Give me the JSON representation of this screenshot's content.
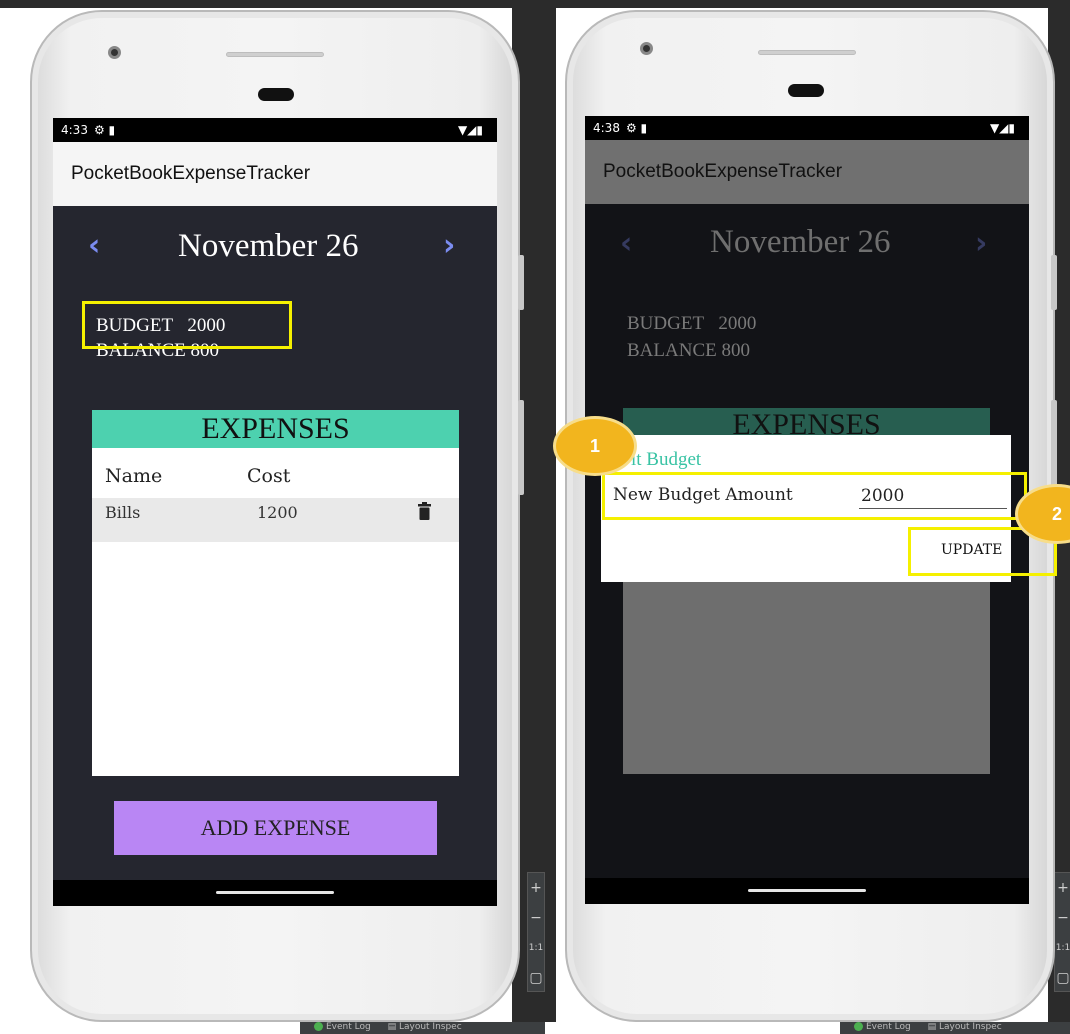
{
  "left_screen": {
    "status_time": "4:33",
    "status_left_icons": "⚙ ▮",
    "status_right_icons": "▼◢▮",
    "app_title": "PocketBookExpenseTracker",
    "prev_arrow": "‹",
    "next_arrow": "›",
    "date": "November 26",
    "budget_label": "BUDGET",
    "budget_value": "2000",
    "balance_label": "BALANCE",
    "balance_value": "800",
    "expenses_header": "EXPENSES",
    "columns": [
      "Name",
      "Cost"
    ],
    "rows": [
      {
        "name": "Bills",
        "cost": "1200",
        "delete_icon": "trash-icon"
      }
    ],
    "add_button": "ADD EXPENSE"
  },
  "right_screen": {
    "status_time": "4:38",
    "status_left_icons": "⚙ ▮",
    "status_right_icons": "▼◢▮",
    "app_title": "PocketBookExpenseTracker",
    "prev_arrow": "‹",
    "next_arrow": "›",
    "date": "November 26",
    "budget_label": "BUDGET",
    "budget_value": "2000",
    "balance_label": "BALANCE",
    "balance_value": "800",
    "expenses_header": "EXPENSES",
    "dialog": {
      "title": "it Budget",
      "field_label": "New Budget Amount",
      "field_value": "2000",
      "button": "UPDATE"
    }
  },
  "annotations": {
    "badge_1": "1",
    "badge_2": "2"
  },
  "ide": {
    "zoom_in": "+",
    "zoom_out": "−",
    "zoom_reset": "1:1",
    "footer_event_log": "Event Log",
    "footer_layout_inspector": "Layout Inspec"
  },
  "colors": {
    "dark_bg": "#25262f",
    "dark_bg_dimmed": "#121317",
    "teal": "#4dd1af",
    "purple_button": "#b986f4",
    "highlight_yellow": "#f5f000",
    "badge_orange": "#f2b51e",
    "arrow_blue": "#7b8cf0"
  }
}
